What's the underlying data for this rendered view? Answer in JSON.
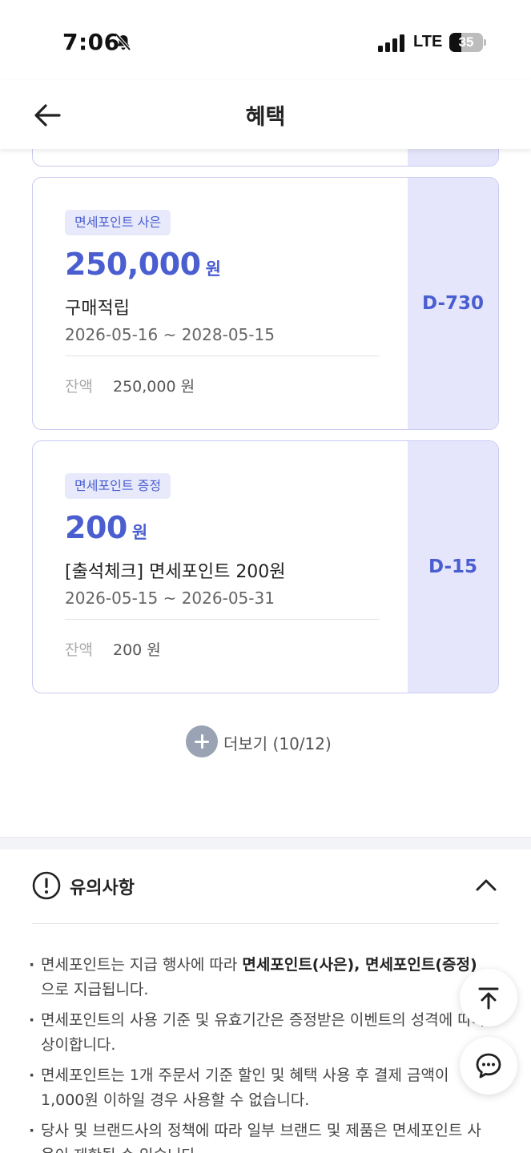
{
  "status_bar": {
    "time": "7:06",
    "network": "LTE",
    "battery": "35",
    "battery_level": 0.35
  },
  "header": {
    "title": "혜택"
  },
  "coupons": [
    {
      "badge": "면세포인트 사은",
      "amount": "250,000",
      "unit": "원",
      "name": "구매적립",
      "period": "2026-05-16 ~ 2028-05-15",
      "balance_label": "잔액",
      "balance": "250,000 원",
      "dday": "D-730"
    },
    {
      "badge": "면세포인트 증정",
      "amount": "200",
      "unit": "원",
      "name": "[출석체크] 면세포인트 200원",
      "period": "2026-05-15 ~ 2026-05-31",
      "balance_label": "잔액",
      "balance": "200 원",
      "dday": "D-15"
    }
  ],
  "more": {
    "label": "더보기 (10/12)"
  },
  "notice": {
    "title": "유의사항",
    "items": [
      {
        "pre": "면세포인트는 지급 행사에 따라 ",
        "bold": "면세포인트(사은), 면세포인트(증정)",
        "post": "으로 지급됩니다."
      },
      {
        "text": "면세포인트의 사용 기준 및 유효기간은 증정받은 이벤트의 성격에 따라 상이합니다."
      },
      {
        "text": "면세포인트는 1개 주문서 기준 할인 및 혜택 사용 후 결제 금액이 1,000원 이하일 경우 사용할 수 없습니다."
      },
      {
        "text": "당사 및 브랜드사의 정책에 따라 일부 브랜드 및 제품은 면세포인트 사용이 제한될 수 있습니다."
      }
    ]
  },
  "colors": {
    "accent": "#4a5ed0",
    "coupon_border": "#c9cbf2",
    "coupon_side": "#e5e6fb"
  }
}
